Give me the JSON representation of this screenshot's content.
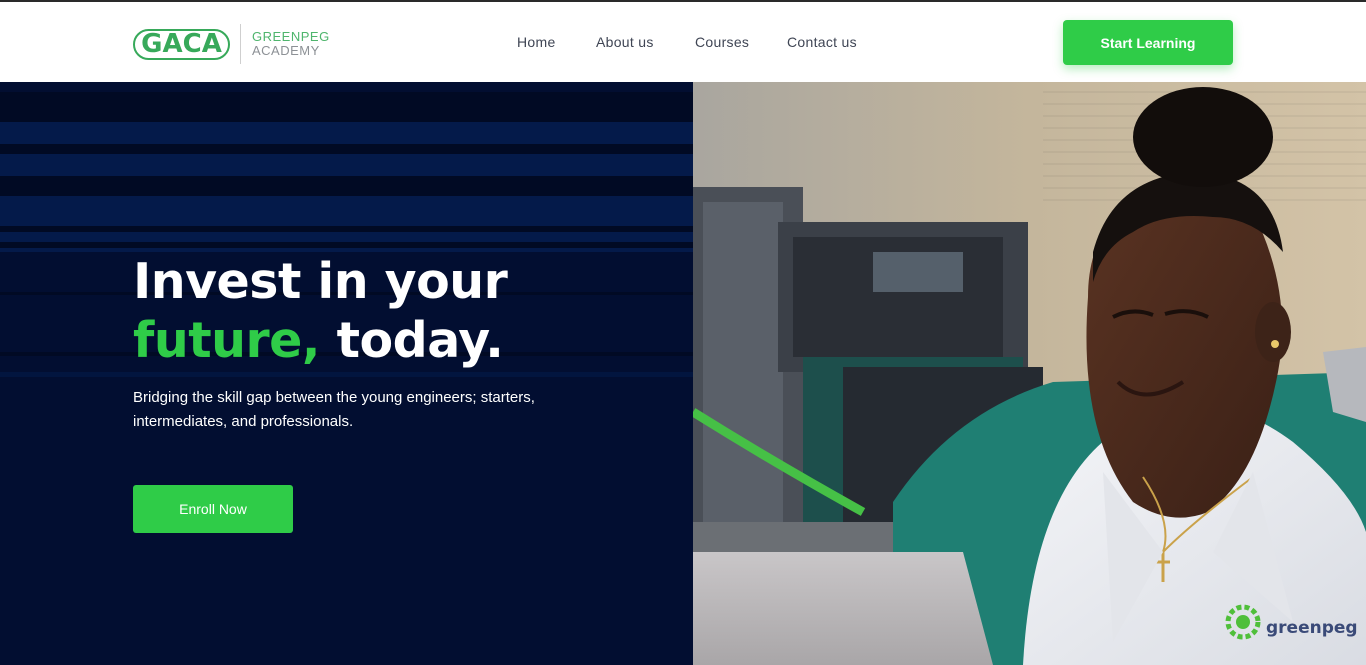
{
  "header": {
    "logo": {
      "mark": "GACA",
      "line1": "GREENPEG",
      "line2": "ACADEMY"
    },
    "nav": [
      {
        "label": "Home"
      },
      {
        "label": "About us"
      },
      {
        "label": "Courses"
      },
      {
        "label": "Contact us"
      }
    ],
    "cta_label": "Start Learning"
  },
  "hero": {
    "headline_line1": "Invest in your",
    "headline_green": "future,",
    "headline_rest": " today.",
    "subtext": "Bridging the skill gap between the young engineers; starters, intermediates, and professionals.",
    "enroll_label": "Enroll Now",
    "photo_shirt_logo": "greenpeg"
  },
  "colors": {
    "accent_green": "#2fcc48",
    "hero_navy": "#020e31",
    "logo_green": "#37a95a",
    "nav_text": "#3f4554"
  }
}
